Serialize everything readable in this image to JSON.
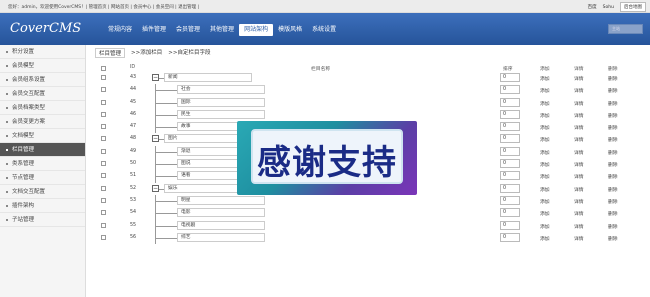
{
  "topbar": {
    "welcome": "您好：admin，欢迎使用CoverCMS！| 管理首页 | 网站首页 | 会员中心 | 会员空间 | 退出管理 |",
    "links": [
      "百度",
      "Sohu"
    ],
    "button": "后台地图"
  },
  "nav": {
    "logo": "CoverCMS",
    "menu": [
      "常规内容",
      "插件管理",
      "会员管理",
      "其他管理",
      "网站架构",
      "模版风格",
      "系统设置"
    ],
    "active_index": 4,
    "select_value": "主站"
  },
  "sidebar": {
    "items": [
      "积分设置",
      "会员模型",
      "会员组系设置",
      "会员交互配置",
      "会员档案类型",
      "会员变更方案",
      "文档模型",
      "栏目管理",
      "类系管理",
      "节点管理",
      "文档交互配置",
      "插件架构",
      "子站管理"
    ],
    "active_index": 7
  },
  "breadcrumb": [
    "栏目管理",
    ">>添加栏目",
    ">>自定栏目字段"
  ],
  "table": {
    "headers": {
      "id": "ID",
      "name": "栏目名称",
      "order": "排序"
    },
    "action_labels": [
      "添加",
      "详情",
      "删除"
    ],
    "rows": [
      {
        "id": "43",
        "name": "新闻",
        "level": 0,
        "order": "0"
      },
      {
        "id": "44",
        "name": "社会",
        "level": 1,
        "order": "0"
      },
      {
        "id": "45",
        "name": "国际",
        "level": 1,
        "order": "0"
      },
      {
        "id": "46",
        "name": "民生",
        "level": 1,
        "order": "0"
      },
      {
        "id": "47",
        "name": "故事",
        "level": 1,
        "order": "0"
      },
      {
        "id": "48",
        "name": "图片",
        "level": 0,
        "order": "0"
      },
      {
        "id": "49",
        "name": "渐退",
        "level": 1,
        "order": "0"
      },
      {
        "id": "50",
        "name": "图说",
        "level": 1,
        "order": "0"
      },
      {
        "id": "51",
        "name": "语看",
        "level": 1,
        "order": "0"
      },
      {
        "id": "52",
        "name": "娱乐",
        "level": 0,
        "order": "0"
      },
      {
        "id": "53",
        "name": "明星",
        "level": 1,
        "order": "0"
      },
      {
        "id": "54",
        "name": "电影",
        "level": 1,
        "order": "0"
      },
      {
        "id": "55",
        "name": "电视剧",
        "level": 1,
        "order": "0"
      },
      {
        "id": "56",
        "name": "综艺",
        "level": 1,
        "order": "0"
      }
    ]
  },
  "overlay": {
    "text": "感谢支持"
  }
}
